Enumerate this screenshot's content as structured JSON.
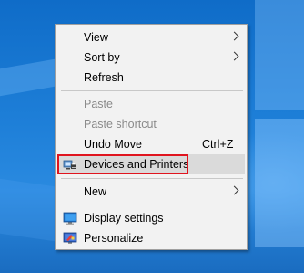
{
  "menu": {
    "items": [
      {
        "label": "View",
        "has_submenu": true
      },
      {
        "label": "Sort by",
        "has_submenu": true
      },
      {
        "label": "Refresh"
      },
      {
        "label": "Paste",
        "disabled": true
      },
      {
        "label": "Paste shortcut",
        "disabled": true
      },
      {
        "label": "Undo Move",
        "shortcut": "Ctrl+Z"
      },
      {
        "label": "Devices and Printers",
        "icon": "devices-printers-icon",
        "highlighted": true
      },
      {
        "label": "New",
        "has_submenu": true
      },
      {
        "label": "Display settings",
        "icon": "display-icon"
      },
      {
        "label": "Personalize",
        "icon": "personalize-icon"
      }
    ]
  },
  "colors": {
    "desktop": "#1a78d2",
    "menu_bg": "#f2f2f2",
    "highlight_bg": "#dadada",
    "annotation_border": "#e0141e"
  }
}
